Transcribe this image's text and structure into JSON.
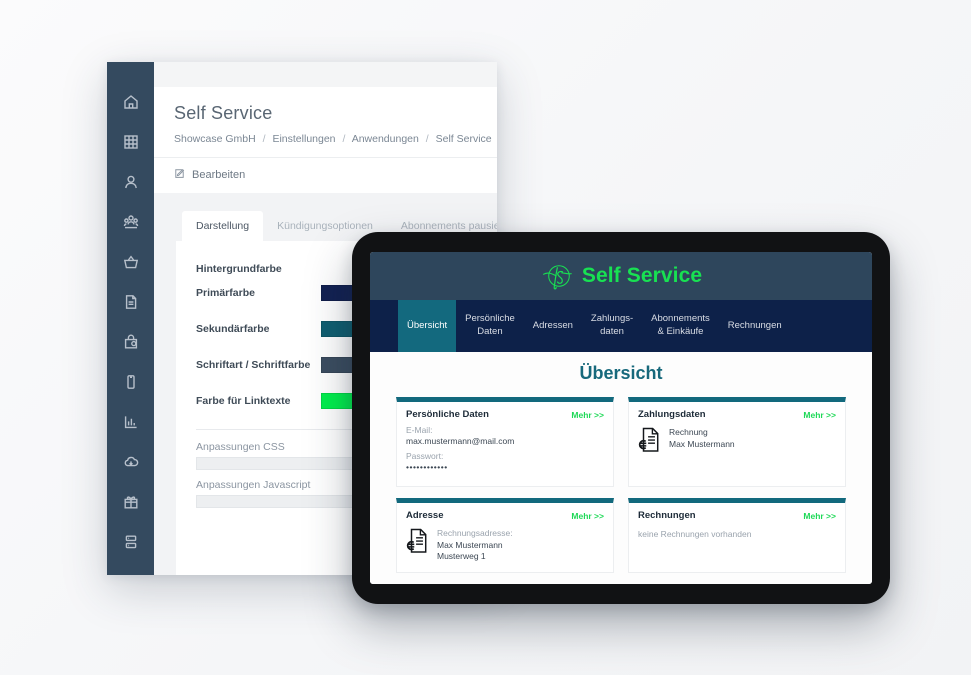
{
  "colors": {
    "page_background": "#f7f8f9",
    "sidebar": "#344a5f",
    "accent_green": "#13e04f",
    "teal": "#13697e",
    "navy": "#0d2149",
    "header_slate": "#2e465c"
  },
  "desktop": {
    "sidebar": {
      "items": [
        {
          "icon": "home-icon",
          "active": false
        },
        {
          "icon": "grid-icon",
          "active": false
        },
        {
          "icon": "user-icon",
          "active": false
        },
        {
          "icon": "users-group-icon",
          "active": false
        },
        {
          "icon": "basket-icon",
          "active": false
        },
        {
          "icon": "document-icon",
          "active": false
        },
        {
          "icon": "shopping-bag-icon",
          "active": false
        },
        {
          "icon": "mobile-icon",
          "active": false
        },
        {
          "icon": "bar-chart-icon",
          "active": false
        },
        {
          "icon": "cloud-download-icon",
          "active": false
        },
        {
          "icon": "gift-icon",
          "active": false
        },
        {
          "icon": "server-icon",
          "active": false
        },
        {
          "icon": "gears-icon",
          "active": false
        },
        {
          "icon": "wrench-icon",
          "active": true
        }
      ]
    },
    "header": {
      "title": "Self Service",
      "breadcrumb": [
        "Showcase GmbH",
        "Einstellungen",
        "Anwendungen",
        "Self Service"
      ],
      "breadcrumb_separator": "/"
    },
    "action_bar": {
      "edit_label": "Bearbeiten",
      "edit_icon": "pencil-square-icon"
    },
    "tabs": [
      {
        "label": "Darstellung",
        "active": true
      },
      {
        "label": "Kündigungsoptionen",
        "active": false
      },
      {
        "label": "Abonnements pausieren",
        "active": false
      }
    ],
    "form": {
      "fields": [
        {
          "label": "Hintergrundfarbe",
          "swatch": null
        },
        {
          "label": "Primärfarbe",
          "swatch": "#122152"
        },
        {
          "label": "Sekundärfarbe",
          "swatch": "#0f5e70"
        },
        {
          "label": "Schriftart / Schriftfarbe",
          "swatch": "#3b4d60"
        },
        {
          "label": "Farbe für Linktexte",
          "swatch": "#00ef4d"
        }
      ],
      "code_fields": [
        {
          "label": "Anpassungen CSS",
          "value": ""
        },
        {
          "label": "Anpassungen Javascript",
          "value": ""
        }
      ]
    }
  },
  "tablet": {
    "brand": {
      "logo_icon": "script-monogram-logo",
      "title": "Self Service"
    },
    "nav_tabs": [
      {
        "label": "Übersicht",
        "active": true
      },
      {
        "label": "Persönliche\nDaten",
        "active": false
      },
      {
        "label": "Adressen",
        "active": false
      },
      {
        "label": "Zahlungs-\ndaten",
        "active": false
      },
      {
        "label": "Abonnements\n& Einkäufe",
        "active": false
      },
      {
        "label": "Rechnungen",
        "active": false
      }
    ],
    "page_heading": "Übersicht",
    "more_label": "Mehr >>",
    "cards": [
      {
        "title": "Persönliche Daten",
        "type": "kv",
        "rows": [
          {
            "label": "E-Mail:",
            "value": "max.mustermann@mail.com"
          },
          {
            "label": "Passwort:",
            "value": "••••••••••••"
          }
        ]
      },
      {
        "title": "Zahlungsdaten",
        "type": "icon",
        "icon": "invoice-euro-icon",
        "lines": [
          "Rechnung",
          "Max Mustermann"
        ],
        "muted_first": false
      },
      {
        "title": "Adresse",
        "type": "icon",
        "icon": "invoice-euro-icon",
        "lines": [
          "Rechnungsadresse:",
          "Max Mustermann",
          "Musterweg 1"
        ],
        "muted_first": true
      },
      {
        "title": "Rechnungen",
        "type": "empty",
        "empty_text": "keine Rechnungen vorhanden"
      }
    ]
  }
}
